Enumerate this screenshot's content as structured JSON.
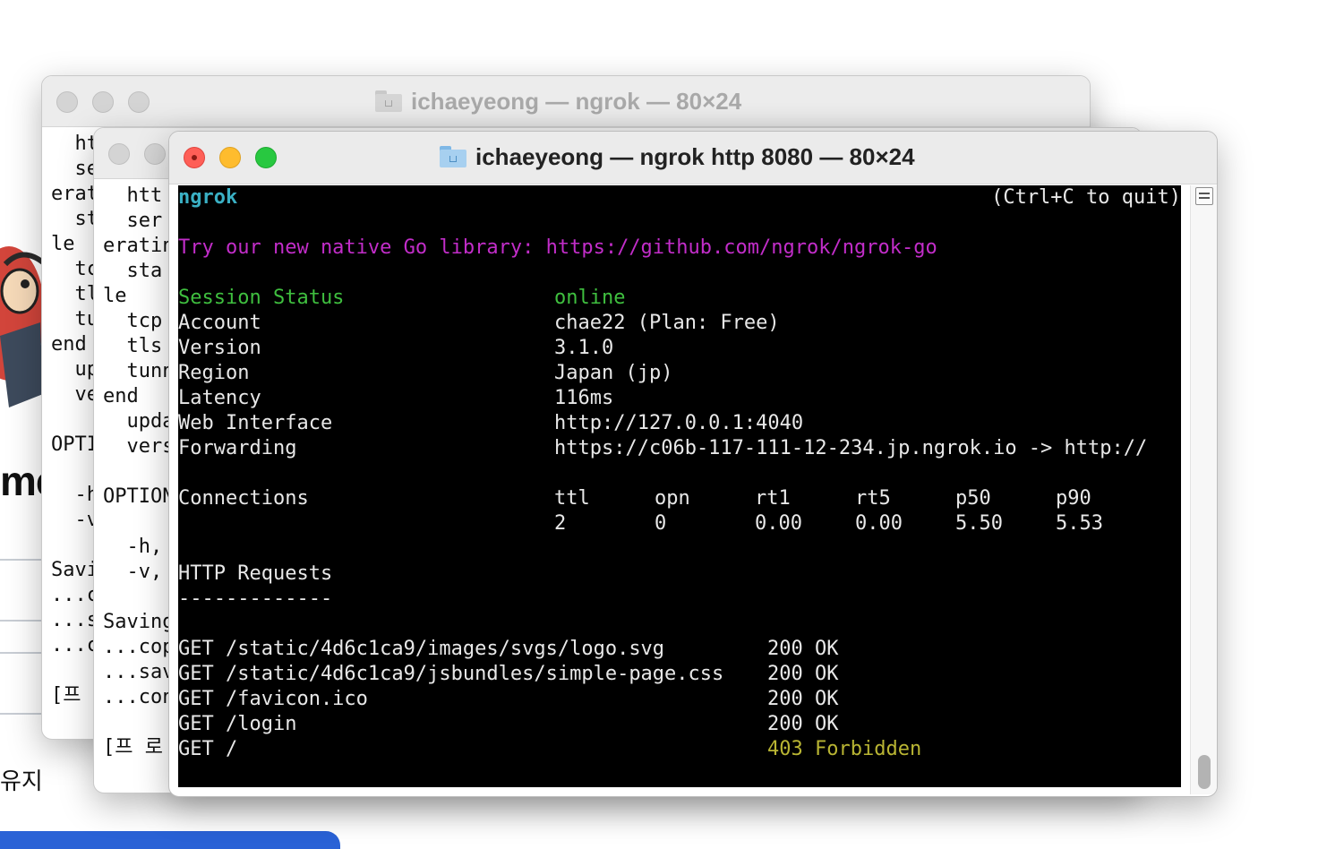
{
  "background_page": {
    "title_fragment": "me",
    "korean_fragment": "유지"
  },
  "back_window": {
    "title": "ichaeyeong — ngrok — 80×24",
    "lines": [
      "  ht",
      "  se",
      "erat",
      "  st",
      "le",
      "  tc",
      "  tl",
      "  tu",
      "end",
      "  up",
      "  ve",
      "",
      "OPTI",
      "",
      "  -h",
      "  -v",
      "",
      "Savi",
      "...c",
      "...s",
      "...c",
      "",
      "[프 로"
    ]
  },
  "middle_window": {
    "lines": [
      "  htt",
      "  ser",
      "eratin",
      "  sta",
      "le",
      "  tcp",
      "  tls",
      "  tunn",
      "end",
      "  upda",
      "  vers",
      "",
      "OPTION",
      "",
      "  -h,",
      "  -v,",
      "",
      "Saving",
      "...cop",
      "...sav",
      "...con",
      "",
      "[프 로 ㅅ"
    ]
  },
  "front_window": {
    "title": "ichaeyeong — ngrok http 8080 — 80×24",
    "brand": "ngrok",
    "quit_hint": "(Ctrl+C to quit)",
    "promo": "Try our new native Go library: https://github.com/ngrok/ngrok-go",
    "status_rows": [
      {
        "label": "Session Status",
        "value": "online"
      },
      {
        "label": "Account",
        "value": "chae22 (Plan: Free)"
      },
      {
        "label": "Version",
        "value": "3.1.0"
      },
      {
        "label": "Region",
        "value": "Japan (jp)"
      },
      {
        "label": "Latency",
        "value": "116ms"
      },
      {
        "label": "Web Interface",
        "value": "http://127.0.0.1:4040"
      },
      {
        "label": "Forwarding",
        "value": "https://c06b-117-111-12-234.jp.ngrok.io -> http://"
      }
    ],
    "connections": {
      "label": "Connections",
      "headers": [
        "ttl",
        "opn",
        "rt1",
        "rt5",
        "p50",
        "p90"
      ],
      "values": [
        "2",
        "0",
        "0.00",
        "0.00",
        "5.50",
        "5.53"
      ]
    },
    "http_requests": {
      "label": "HTTP Requests",
      "underline": "-------------",
      "rows": [
        {
          "request": "GET /static/4d6c1ca9/images/svgs/logo.svg",
          "status": "200 OK"
        },
        {
          "request": "GET /static/4d6c1ca9/jsbundles/simple-page.css",
          "status": "200 OK"
        },
        {
          "request": "GET /favicon.ico",
          "status": "200 OK"
        },
        {
          "request": "GET /login",
          "status": "200 OK"
        },
        {
          "request": "GET /",
          "status": "403 Forbidden"
        }
      ]
    }
  },
  "colors": {
    "brand": "#3ab0c4",
    "promo": "#c22dc9",
    "online": "#3fbf3f",
    "forbidden": "#b9b533",
    "close": "#fe5f57",
    "minimize": "#febc2e",
    "zoom": "#28c840"
  },
  "icons": [
    "folder-icon",
    "scroll-toggle-icon"
  ]
}
